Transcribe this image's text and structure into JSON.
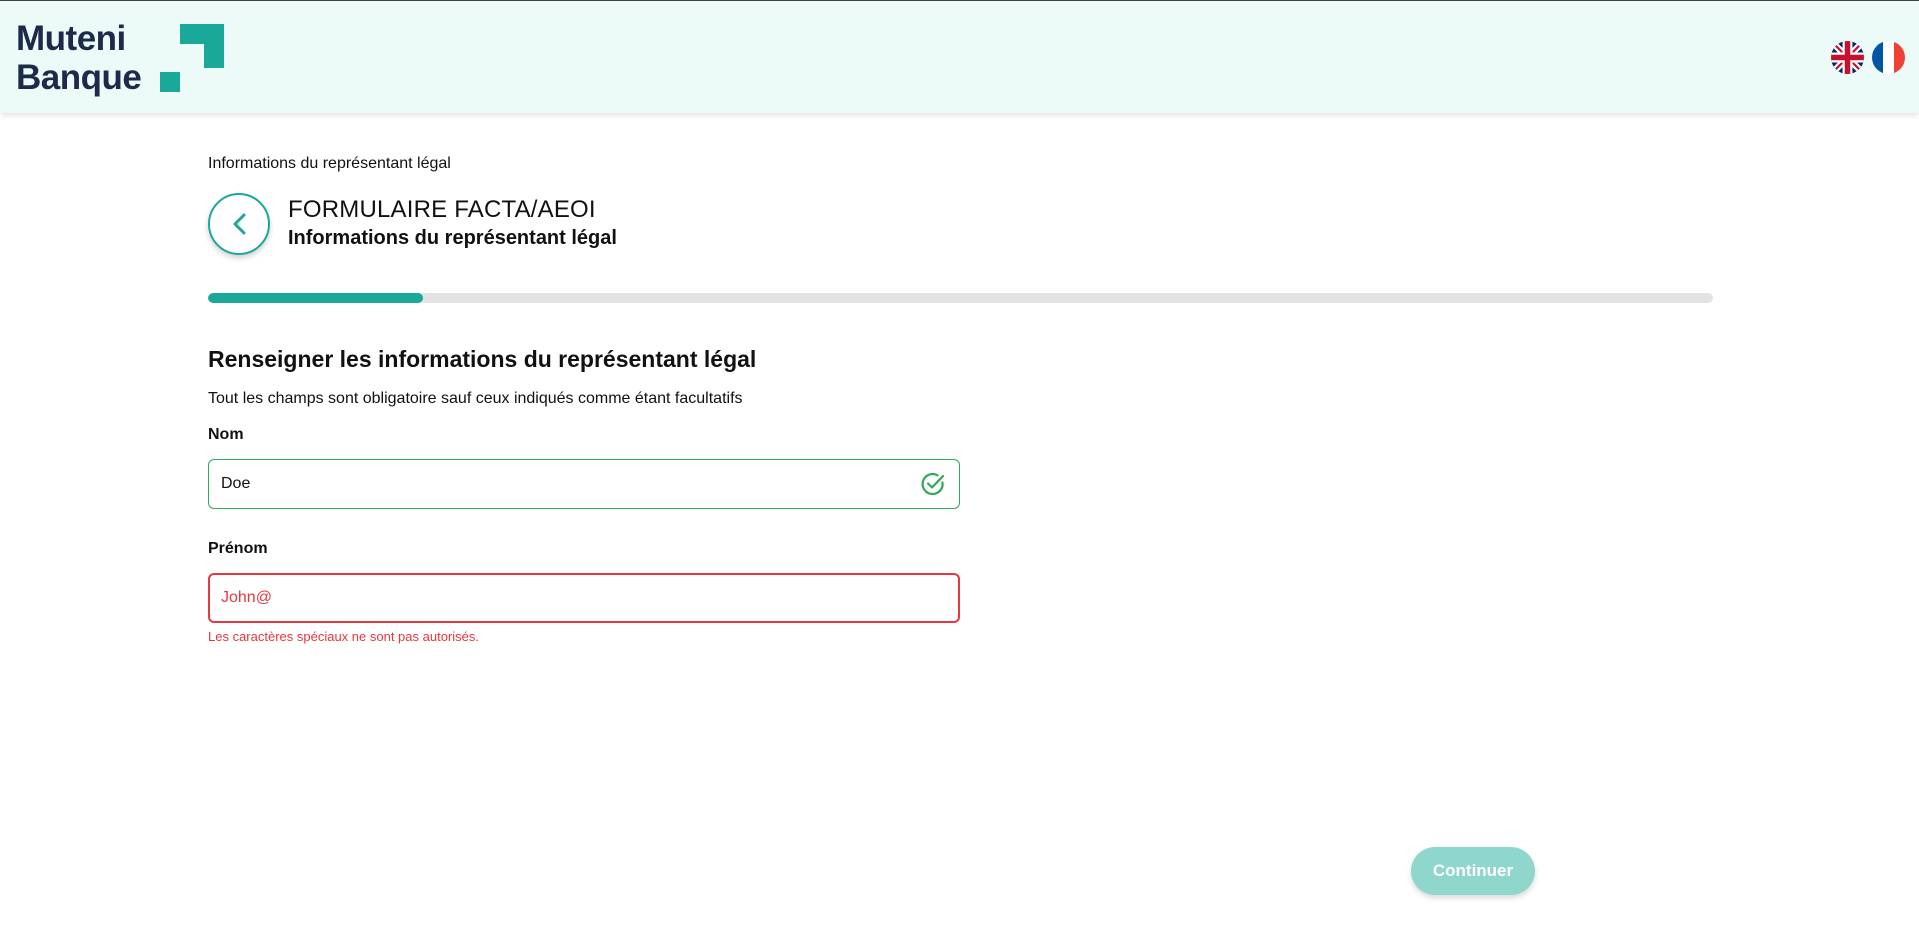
{
  "header": {
    "brand_line1": "Muteni",
    "brand_line2": "Banque",
    "languages": [
      {
        "code": "en",
        "icon": "uk-flag-icon"
      },
      {
        "code": "fr",
        "icon": "france-flag-icon"
      }
    ]
  },
  "breadcrumb": "Informations du représentant légal",
  "form": {
    "title": "FORMULAIRE FACTA/AEOI",
    "subtitle": "Informations du représentant légal",
    "progress_percent": 14.3
  },
  "section": {
    "title": "Renseigner les informations du représentant légal",
    "description": "Tout les champs sont obligatoire sauf ceux indiqués comme étant facultatifs"
  },
  "fields": {
    "nom": {
      "label": "Nom",
      "value": "Doe",
      "status": "valid",
      "status_icon": "check-circle-icon"
    },
    "prenom": {
      "label": "Prénom",
      "value": "John@",
      "status": "error",
      "error": "Les caractères spéciaux ne sont pas autorisés."
    }
  },
  "actions": {
    "continue_label": "Continuer"
  },
  "colors": {
    "accent": "#1aa999",
    "header_bg": "#edfbf8",
    "brand_text": "#1d2a4a",
    "valid": "#2ea85b",
    "error": "#e5383f",
    "button_disabled": "#8fd6cd"
  }
}
